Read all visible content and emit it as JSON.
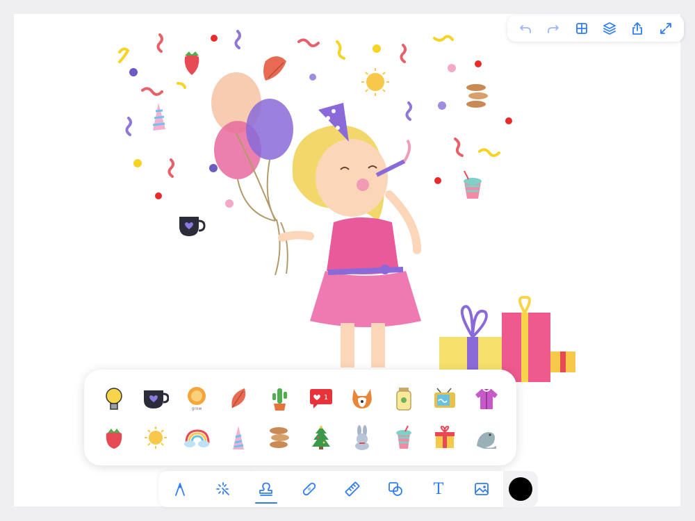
{
  "colors": {
    "accent": "#2f7cf6",
    "disabled": "#9cb8f5",
    "selected_color": "#000000"
  },
  "top_toolbar": {
    "items": [
      {
        "name": "undo-icon",
        "enabled": false
      },
      {
        "name": "redo-icon",
        "enabled": false
      },
      {
        "name": "grid-icon",
        "enabled": true
      },
      {
        "name": "layers-icon",
        "enabled": true
      },
      {
        "name": "share-icon",
        "enabled": true
      },
      {
        "name": "expand-icon",
        "enabled": true
      }
    ]
  },
  "palette": {
    "row1": [
      "lightbulb-icon",
      "coffee-mug-icon",
      "lion-icon",
      "leaf-icon",
      "cactus-icon",
      "notification-heart-icon",
      "corgi-icon",
      "jar-icon",
      "tv-icon",
      "jacket-icon"
    ],
    "row2": [
      "strawberry-icon",
      "sun-icon",
      "rainbow-cloud-icon",
      "unicorn-horn-icon",
      "macarons-icon",
      "christmas-tree-icon",
      "bunny-icon",
      "drink-cup-icon",
      "gift-box-icon",
      "seal-icon"
    ],
    "notification_count": "1",
    "lion_caption": "grow"
  },
  "tools": {
    "items": [
      "pen-tool-icon",
      "magic-wand-icon",
      "stamp-icon",
      "bandage-icon",
      "ruler-icon",
      "shapes-icon",
      "text-icon",
      "image-icon"
    ],
    "active": "stamp-icon",
    "text_glyph": "T"
  }
}
